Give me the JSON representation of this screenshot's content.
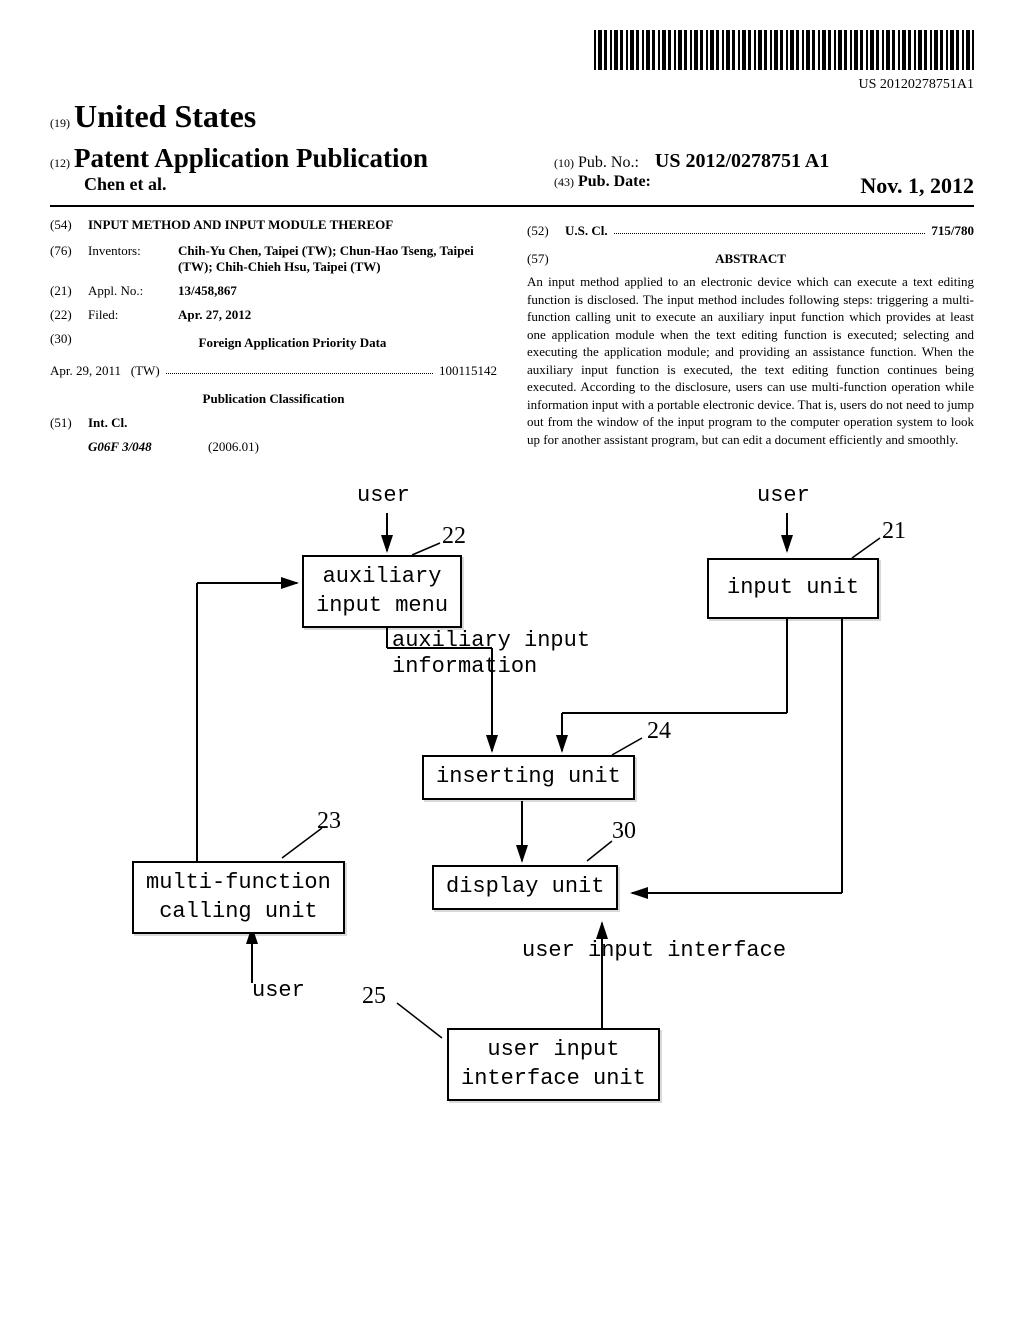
{
  "barcode_text": "US 20120278751A1",
  "header": {
    "country_num": "(19)",
    "country": "United States",
    "pub_num": "(12)",
    "pub_type": "Patent Application Publication",
    "author": "Chen et al.",
    "pubno_num": "(10)",
    "pubno_label": "Pub. No.:",
    "pubno_value": "US 2012/0278751 A1",
    "pubdate_num": "(43)",
    "pubdate_label": "Pub. Date:",
    "pubdate_value": "Nov. 1, 2012"
  },
  "left": {
    "title_num": "(54)",
    "title": "INPUT METHOD AND INPUT MODULE THEREOF",
    "inventors_num": "(76)",
    "inventors_label": "Inventors:",
    "inventors_value": "Chih-Yu Chen, Taipei (TW); Chun-Hao Tseng, Taipei (TW); Chih-Chieh Hsu, Taipei (TW)",
    "appl_num": "(21)",
    "appl_label": "Appl. No.:",
    "appl_value": "13/458,867",
    "filed_num": "(22)",
    "filed_label": "Filed:",
    "filed_value": "Apr. 27, 2012",
    "priority_num": "(30)",
    "priority_heading": "Foreign Application Priority Data",
    "priority_date": "Apr. 29, 2011",
    "priority_country": "(TW)",
    "priority_appno": "100115142",
    "pubclass_heading": "Publication Classification",
    "intcl_num": "(51)",
    "intcl_label": "Int. Cl.",
    "intcl_code": "G06F 3/048",
    "intcl_year": "(2006.01)"
  },
  "right": {
    "uscl_num": "(52)",
    "uscl_label": "U.S. Cl.",
    "uscl_value": "715/780",
    "abstract_num": "(57)",
    "abstract_heading": "ABSTRACT",
    "abstract_text": "An input method applied to an electronic device which can execute a text editing function is disclosed. The input method includes following steps: triggering a multi-function calling unit to execute an auxiliary input function which provides at least one application module when the text editing function is executed; selecting and executing the application module; and providing an assistance function. When the auxiliary input function is executed, the text editing function continues being executed. According to the disclosure, users can use multi-function operation while information input with a portable electronic device. That is, users do not need to jump out from the window of the input program to the computer operation system to look up for another assistant program, but can edit a document efficiently and smoothly."
  },
  "diagram": {
    "user1": "user",
    "user2": "user",
    "user3": "user",
    "box22": "auxiliary\ninput menu",
    "aux_info": "auxiliary input\ninformation",
    "box21": "input unit",
    "box24": "inserting unit",
    "box23": "multi-function\ncalling unit",
    "box30": "display unit",
    "box25": "user input\ninterface unit",
    "uii_label": "user input interface",
    "ref21": "21",
    "ref22": "22",
    "ref23": "23",
    "ref24": "24",
    "ref25": "25",
    "ref30": "30"
  }
}
